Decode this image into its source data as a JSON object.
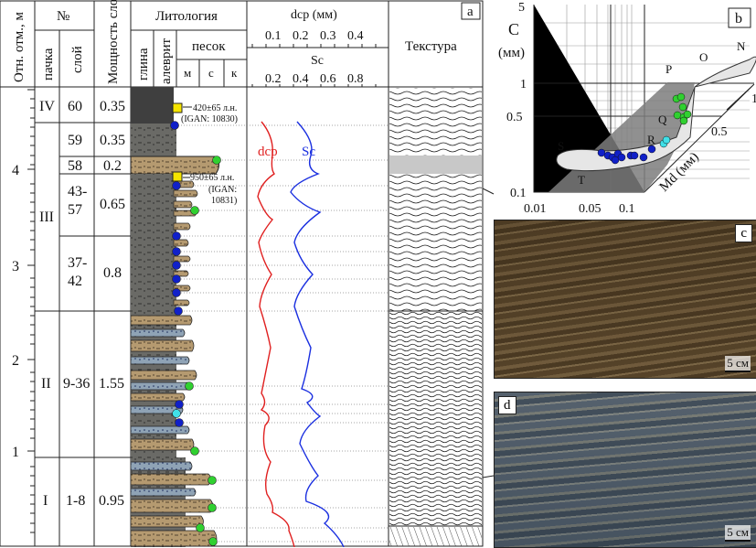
{
  "header": {
    "depth": "Отн. отм., м",
    "number": "№",
    "pack": "пачка",
    "layer": "слой",
    "thickness": "Мощность слоя, м",
    "lithology": "Литология",
    "clay": "глина",
    "silt": "алеврит",
    "sand": "песок",
    "sand_f": "м",
    "sand_m": "с",
    "sand_c": "к",
    "dcp_title": "dср (мм)",
    "dcp_ticks": [
      "0.1",
      "0.2",
      "0.3",
      "0.4"
    ],
    "sc_title": "Sc",
    "sc_ticks": [
      "0.2",
      "0.4",
      "0.6",
      "0.8"
    ],
    "texture": "Текстура",
    "panel_a": "a"
  },
  "depth_ticks": [
    "4",
    "3",
    "2",
    "1"
  ],
  "packs": [
    {
      "pack": "IV",
      "layer": "60",
      "thickness": "0.35"
    },
    {
      "pack": "",
      "layer": "59",
      "thickness": "0.35"
    },
    {
      "pack": "III",
      "layer": "58",
      "thickness": "0.2"
    },
    {
      "pack": "",
      "layer": "43-\n57",
      "thickness": "0.65"
    },
    {
      "pack": "",
      "layer": "37-\n42",
      "thickness": "0.8"
    },
    {
      "pack": "II",
      "layer": "9-36",
      "thickness": "1.55"
    },
    {
      "pack": "I",
      "layer": "1-8",
      "thickness": "0.95"
    }
  ],
  "dates": [
    {
      "age": "420±65 л.н.",
      "lab": "(IGAN: 10830)"
    },
    {
      "age": "950±65 л.н.",
      "lab": "(IGAN:",
      "lab2": "10831)"
    }
  ],
  "curve_labels": {
    "dcp": "dср",
    "sc": "Sc"
  },
  "colors": {
    "dcp": "#e02020",
    "sc": "#1a2fe0",
    "blue_dot": "#1020c8",
    "green_dot": "#30d030",
    "cyan_dot": "#40e0e8",
    "date_marker": "#f5e400",
    "sand": "#b59a70",
    "clay": "#4a4a4a"
  },
  "panel_b": {
    "label": "b",
    "y_axis": "C",
    "y_unit": "(мм)",
    "y_ticks": [
      "5",
      "1",
      "0.5",
      "0.1"
    ],
    "x_ticks": [
      "0.01",
      "0.05",
      "0.1"
    ],
    "md_axis": "Md (мм)",
    "md_ticks": [
      "0.5",
      "1"
    ],
    "fields": [
      "N",
      "O",
      "P",
      "Q",
      "R",
      "S",
      "T"
    ]
  },
  "panel_c": {
    "label": "c",
    "scale": "5 см"
  },
  "panel_d": {
    "label": "d",
    "scale": "5 см"
  }
}
